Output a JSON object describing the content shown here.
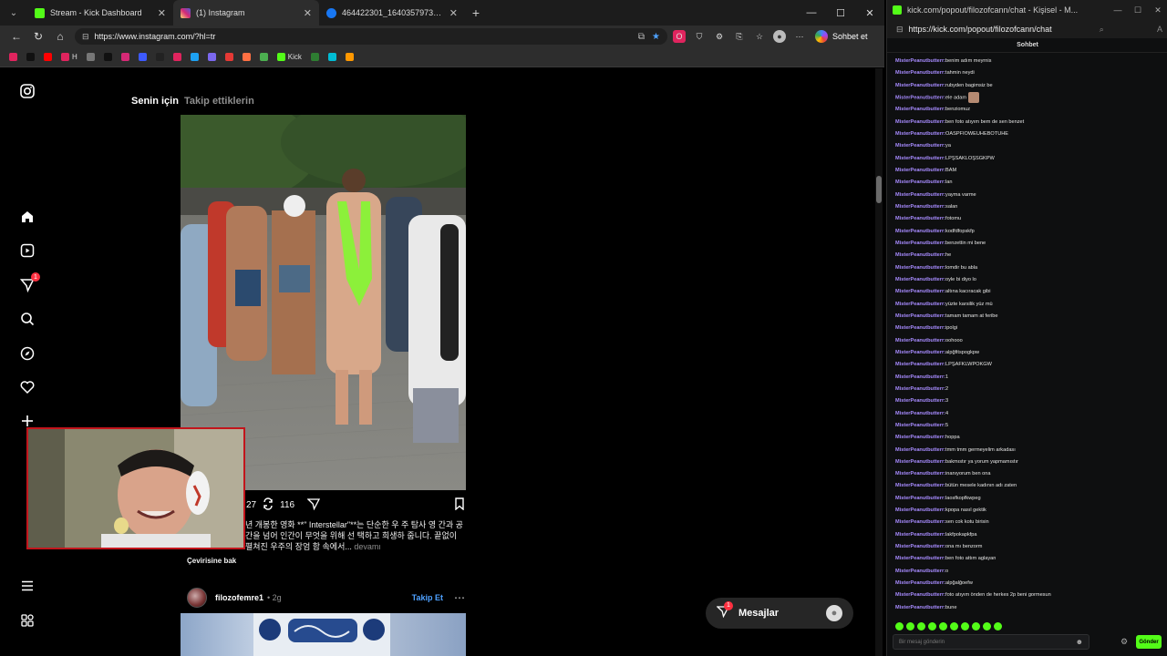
{
  "browser": {
    "tabs": [
      {
        "label": "Stream - Kick Dashboard",
        "favicon_color": "#53fc18"
      },
      {
        "label": "(1) Instagram",
        "favicon_color": "#d62976"
      },
      {
        "label": "464422301_1640357973361609_4…",
        "favicon_color": "#1877f2"
      }
    ],
    "new_tab": "+",
    "url": "https://www.instagram.com/?hl=tr",
    "chat_button": "Sohbet et",
    "bookmarks": [
      {
        "label": "",
        "color": "#e0245e"
      },
      {
        "label": "",
        "color": "#111111"
      },
      {
        "label": "",
        "color": "#ff0000"
      },
      {
        "label": "H",
        "color": "#e0245e"
      },
      {
        "label": "",
        "color": "#777777"
      },
      {
        "label": "",
        "color": "#111111"
      },
      {
        "label": "",
        "color": "#d62976"
      },
      {
        "label": "",
        "color": "#3d5afe"
      },
      {
        "label": "",
        "color": "#222222"
      },
      {
        "label": "",
        "color": "#e0245e"
      },
      {
        "label": "",
        "color": "#1da1f2"
      },
      {
        "label": "",
        "color": "#7b68ee"
      },
      {
        "label": "",
        "color": "#e53935"
      },
      {
        "label": "",
        "color": "#ff7043"
      },
      {
        "label": "",
        "color": "#4caf50"
      },
      {
        "label": "Kick",
        "color": "#53fc18"
      },
      {
        "label": "",
        "color": "#2e7d32"
      },
      {
        "label": "",
        "color": "#00bcd4"
      },
      {
        "label": "",
        "color": "#ff9800"
      }
    ]
  },
  "instagram": {
    "feed_tabs": {
      "for_you": "Senin için",
      "following": "Takip ettiklerin"
    },
    "notification_badge": "1",
    "post1": {
      "comments": "27",
      "reposts": "116",
      "caption": "년 개봉한 영화 **\" Interstellar\"**는 단순한 우 주 탐사 영 간과 공간을 넘어 인간이 무엇을 위해 선 택하고 희생하 줍니다. 끝없이 펼쳐진 우주의 장엄 함 속에서...",
      "more": "devamı",
      "translate": "Çevirisine bak"
    },
    "post2": {
      "username": "filozofemre1",
      "time": "• 2g",
      "follow": "Takip Et"
    },
    "messages": {
      "label": "Mesajlar",
      "badge": "1"
    }
  },
  "chat_popout": {
    "window_title": "kick.com/popout/filozofcann/chat - Kişisel - M...",
    "url": "https://kick.com/popout/filozofcann/chat",
    "header": "Sohbet",
    "messages": [
      {
        "user": "MisterPeanutbutterr:",
        "text": "benim adım meyrnis"
      },
      {
        "user": "MisterPeanutbutterr:",
        "text": "tahmin neydi"
      },
      {
        "user": "MisterPeanutbutterr:",
        "text": "rubyden bagimsiz be"
      },
      {
        "user": "MisterPeanutbutterr:",
        "text": "ele adam",
        "emote": true
      },
      {
        "user": "MisterPeanutbutterr:",
        "text": "benziomuz"
      },
      {
        "user": "MisterPeanutbutterr:",
        "text": "ben foto atıyım bem de sen benzet"
      },
      {
        "user": "MisterPeanutbutterr:",
        "text": "OASPFIOWEUHEBOTUHE"
      },
      {
        "user": "MisterPeanutbutterr:",
        "text": "ya"
      },
      {
        "user": "MisterPeanutbutterr:",
        "text": "LPŞSAKLOŞSGKPW"
      },
      {
        "user": "MisterPeanutbutterr:",
        "text": "BAM"
      },
      {
        "user": "MisterPeanutbutterr:",
        "text": "lan"
      },
      {
        "user": "MisterPeanutbutterr:",
        "text": "yayma varme"
      },
      {
        "user": "MisterPeanutbutterr:",
        "text": "salan"
      },
      {
        "user": "MisterPeanutbutterr:",
        "text": "fotomu"
      },
      {
        "user": "MisterPeanutbutterr:",
        "text": "kodfdfopskfp"
      },
      {
        "user": "MisterPeanutbutterr:",
        "text": "benzettin mi bene"
      },
      {
        "user": "MisterPeanutbutterr:",
        "text": "he"
      },
      {
        "user": "MisterPeanutbutterr:",
        "text": "lomdir bu abla"
      },
      {
        "user": "MisterPeanutbutterr:",
        "text": "oyle bi diyo lo"
      },
      {
        "user": "MisterPeanutbutterr:",
        "text": "altına kacıracak gibi"
      },
      {
        "user": "MisterPeanutbutterr:",
        "text": "yüzte karsilik yüz mü"
      },
      {
        "user": "MisterPeanutbutterr:",
        "text": "tamam tamam at feribe"
      },
      {
        "user": "MisterPeanutbutterr:",
        "text": "ipolgi"
      },
      {
        "user": "MisterPeanutbutterr:",
        "text": "oohooo"
      },
      {
        "user": "MisterPeanutbutterr:",
        "text": "alpğfitspogkpw"
      },
      {
        "user": "MisterPeanutbutterr:",
        "text": "LPŞAFKLWPOKGW"
      },
      {
        "user": "MisterPeanutbutterr:",
        "text": "1"
      },
      {
        "user": "MisterPeanutbutterr:",
        "text": "2"
      },
      {
        "user": "MisterPeanutbutterr:",
        "text": "3"
      },
      {
        "user": "MisterPeanutbutterr:",
        "text": "4"
      },
      {
        "user": "MisterPeanutbutterr:",
        "text": "5"
      },
      {
        "user": "MisterPeanutbutterr:",
        "text": "hoppa"
      },
      {
        "user": "MisterPeanutbutterr:",
        "text": "tmm tmm germeyelim arkadası"
      },
      {
        "user": "MisterPeanutbutterr:",
        "text": "bakmıstır ya yorum yapmamıstır"
      },
      {
        "user": "MisterPeanutbutterr:",
        "text": "inanıyorum ben ona"
      },
      {
        "user": "MisterPeanutbutterr:",
        "text": "bütün mesele kadının adı zaten"
      },
      {
        "user": "MisterPeanutbutterr:",
        "text": "laosfkopfkwpeg"
      },
      {
        "user": "MisterPeanutbutterr:",
        "text": "kpopa nasıl gektik"
      },
      {
        "user": "MisterPeanutbutterr:",
        "text": "sen cok kotu birisin"
      },
      {
        "user": "MisterPeanutbutterr:",
        "text": "lakfpokapkfpa"
      },
      {
        "user": "MisterPeanutbutterr:",
        "text": "ona mı benzorm"
      },
      {
        "user": "MisterPeanutbutterr:",
        "text": "ben foto attım aglayan"
      },
      {
        "user": "MisterPeanutbutterr:",
        "text": "o"
      },
      {
        "user": "MisterPeanutbutterr:",
        "text": "alpğalğoefw"
      },
      {
        "user": "MisterPeanutbutterr:",
        "text": "foto atıyım önden de herkes 2p beni gormesun"
      },
      {
        "user": "MisterPeanutbutterr:",
        "text": "bune"
      }
    ],
    "input_placeholder": "Bir mesaj gönderin",
    "send_label": "Gönder"
  }
}
